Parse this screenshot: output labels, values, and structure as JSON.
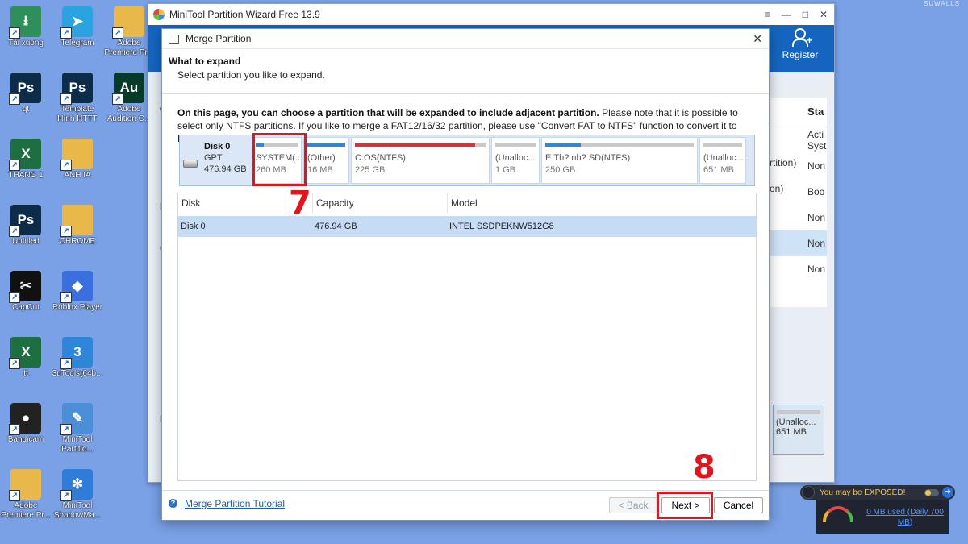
{
  "desktop": {
    "watermark": "SUWALLS",
    "icons": [
      {
        "label": "Tải xuống",
        "icon": "download-folder-icon",
        "color": "#2f8f5a",
        "glyph": "⭳"
      },
      {
        "label": "Telegram",
        "icon": "telegram-icon",
        "color": "#2aa3e0",
        "glyph": "➤"
      },
      {
        "label": "Adobe Premiere Pr...",
        "icon": "folder-icon",
        "color": "#e8b84a",
        "glyph": ""
      },
      {
        "label": "qt",
        "icon": "photoshop-icon",
        "color": "#0c2c4a",
        "glyph": "Ps"
      },
      {
        "label": "Template Hình HTTT",
        "icon": "psd-file-icon",
        "color": "#0c2c4a",
        "glyph": "Ps"
      },
      {
        "label": "Adobe Audition C...",
        "icon": "audition-icon",
        "color": "#063b2a",
        "glyph": "Au"
      },
      {
        "label": "THÁNG 1",
        "icon": "excel-icon",
        "color": "#1d6f42",
        "glyph": "X"
      },
      {
        "label": "ẢNH IA",
        "icon": "folder-icon",
        "color": "#e8b84a",
        "glyph": ""
      },
      {
        "label": "Untitled",
        "icon": "photoshop-icon",
        "color": "#0c2c4a",
        "glyph": "Ps"
      },
      {
        "label": "CHROME",
        "icon": "folder-icon",
        "color": "#e8b84a",
        "glyph": ""
      },
      {
        "label": "CapCut",
        "icon": "capcut-icon",
        "color": "#111111",
        "glyph": "✂"
      },
      {
        "label": "Roblox Player",
        "icon": "roblox-icon",
        "color": "#3b6fe0",
        "glyph": "◆"
      },
      {
        "label": "tt",
        "icon": "excel-icon",
        "color": "#1d6f42",
        "glyph": "X"
      },
      {
        "label": "3uTools(64b...",
        "icon": "3utools-icon",
        "color": "#2f86d8",
        "glyph": "3"
      },
      {
        "label": "Bandicam",
        "icon": "bandicam-icon",
        "color": "#222222",
        "glyph": "●"
      },
      {
        "label": "MiniTool Partitio...",
        "icon": "minitool-partition-icon",
        "color": "#4a8fd8",
        "glyph": "✎"
      },
      {
        "label": "Adobe Premiere Pr...",
        "icon": "premiere-folder-icon",
        "color": "#e8b84a",
        "glyph": ""
      },
      {
        "label": "MiniTool ShadowMa...",
        "icon": "minitool-shadowmaker-icon",
        "color": "#2f7dd8",
        "glyph": "✻"
      }
    ]
  },
  "app": {
    "title": "MiniTool Partition Wizard Free 13.9",
    "controls": [
      "≡",
      "—",
      "□",
      "✕"
    ],
    "register_label": "Register",
    "column_header": "Sta",
    "bg_rows": [
      "Acti Syst",
      "Non",
      "Boo",
      "Non",
      "Non",
      "Non"
    ],
    "bg_partition_notes": [
      "rtition)",
      "on)"
    ],
    "bg_letters": [
      "B",
      "W",
      "E",
      "C",
      "P"
    ],
    "bg_disk": {
      "name": "(Unalloc...",
      "size": "651 MB"
    }
  },
  "dialog": {
    "title": "Merge Partition",
    "close": "✕",
    "header_title": "What to expand",
    "header_subtitle": "Select partition you like to expand.",
    "info_bold": "On this page, you can choose a partition that will be expanded to include adjacent partition.",
    "info_rest": " Please note that it is possible to select only NTFS partitions. If you like to merge a FAT12/16/32 partition, please use \"Convert FAT to NTFS\" function to convert it to NTFS first.",
    "disk": {
      "name": "Disk 0",
      "type": "GPT",
      "size": "476.94 GB"
    },
    "partitions": [
      {
        "name": "SYSTEM(...",
        "size": "260 MB",
        "fill": 0.2,
        "color": "#2f86d8"
      },
      {
        "name": "(Other)",
        "size": "16 MB",
        "fill": 1.0,
        "color": "#2f86d8"
      },
      {
        "name": "C:OS(NTFS)",
        "size": "225 GB",
        "fill": 0.92,
        "color": "#d0343c"
      },
      {
        "name": "(Unalloc...",
        "size": "1 GB",
        "fill": 0,
        "color": "#c9c9c9"
      },
      {
        "name": "E:Th? nh? SD(NTFS)",
        "size": "250 GB",
        "fill": 0.24,
        "color": "#2f86d8"
      },
      {
        "name": "(Unalloc...",
        "size": "651 MB",
        "fill": 0,
        "color": "#c9c9c9"
      }
    ],
    "table": {
      "headers": [
        "Disk",
        "Capacity",
        "Model"
      ],
      "rows": [
        [
          "Disk 0",
          "476.94 GB",
          "INTEL SSDPEKNW512G8"
        ]
      ]
    },
    "tutorial": "Merge Partition Tutorial",
    "back_label": "< Back",
    "next_label": "Next >",
    "cancel_label": "Cancel"
  },
  "annotations": {
    "step7": "7",
    "step8": "8",
    "color": "#e0151e"
  },
  "toast": {
    "warning": "You may be EXPOSED!",
    "usage": "0 MB used (Daily 700 MB)"
  }
}
